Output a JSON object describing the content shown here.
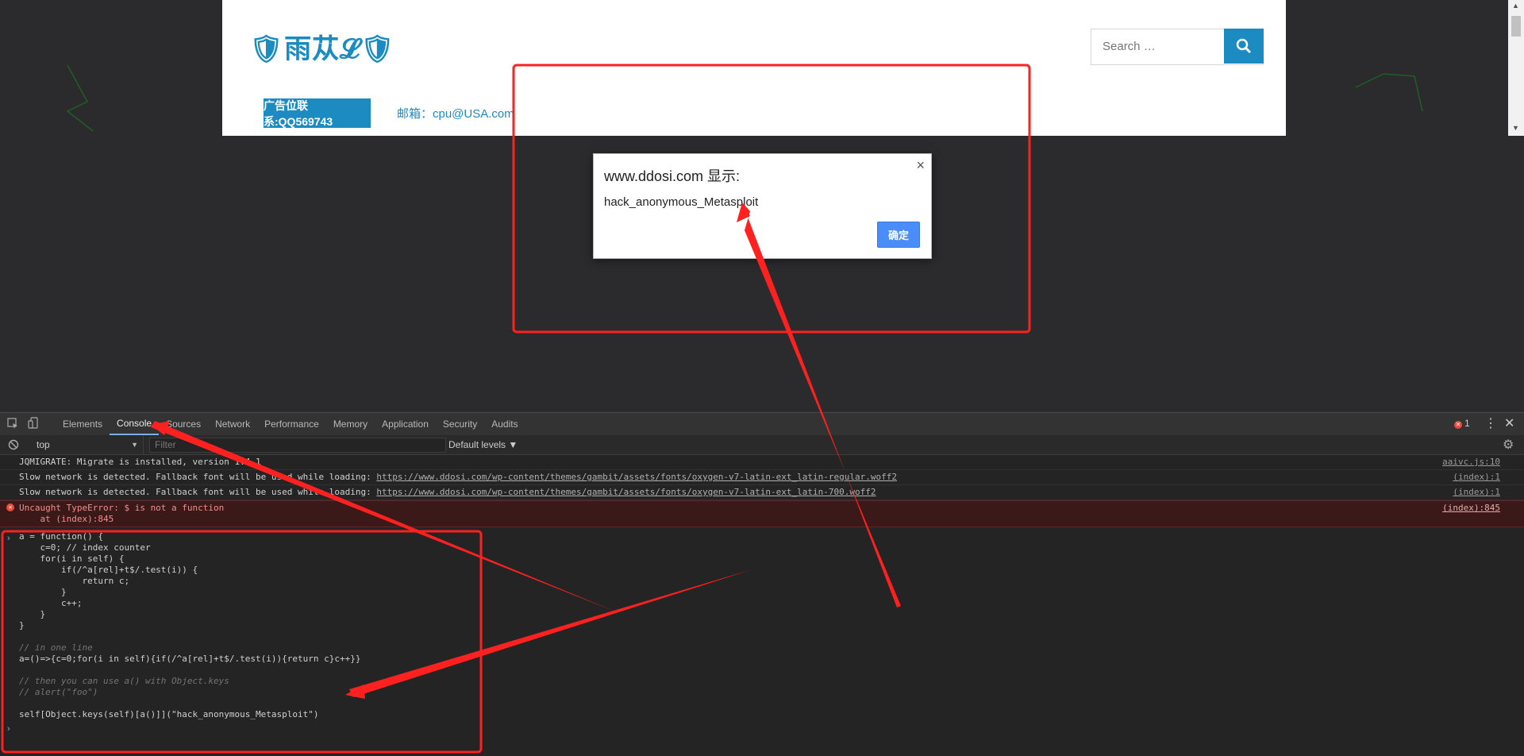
{
  "site": {
    "logo": "🛡雨苁𝓛🛡",
    "search_placeholder": "Search …",
    "ad_label": "广告位联系:QQ569743",
    "email_text": "邮箱：cpu@USA.com"
  },
  "dialog": {
    "title": "www.ddosi.com 显示:",
    "message": "hack_anonymous_Metasploit",
    "ok_label": "确定",
    "close_icon": "×"
  },
  "devtools": {
    "tabs": [
      "Elements",
      "Console",
      "Sources",
      "Network",
      "Performance",
      "Memory",
      "Application",
      "Security",
      "Audits"
    ],
    "active_tab": "Console",
    "error_count": "1",
    "context": "top",
    "filter_placeholder": "Filter",
    "levels_label": "Default levels ▼"
  },
  "console": {
    "messages": [
      {
        "text": "JQMIGRATE: Migrate is installed, version 1.4.1",
        "url": "",
        "source": "aaivc.js:10",
        "type": "log"
      },
      {
        "text": "Slow network is detected. Fallback font will be used while loading: ",
        "url": "https://www.ddosi.com/wp-content/themes/gambit/assets/fonts/oxygen-v7-latin-ext_latin-regular.woff2",
        "source": "(index):1",
        "type": "log"
      },
      {
        "text": "Slow network is detected. Fallback font will be used while loading: ",
        "url": "https://www.ddosi.com/wp-content/themes/gambit/assets/fonts/oxygen-v7-latin-ext_latin-700.woff2",
        "source": "(index):1",
        "type": "log"
      }
    ],
    "error": {
      "line1": "Uncaught TypeError: $ is not a function",
      "line2": "    at (index):845",
      "source": "(index):845"
    },
    "code_lines": [
      "a = function() {",
      "    c=0; // index counter",
      "    for(i in self) {",
      "        if(/^a[rel]+t$/.test(i)) {",
      "            return c;",
      "        }",
      "        c++;",
      "    }",
      "}",
      "",
      "// in one line",
      "a=()=>{c=0;for(i in self){if(/^a[rel]+t$/.test(i)){return c}c++}}",
      "",
      "// then you can use a() with Object.keys",
      "// alert(\"foo\")",
      "",
      "self[Object.keys(self)[a()]](\"hack_anonymous_Metasploit\")"
    ]
  },
  "colors": {
    "brand": "#1b8bc1",
    "annotation": "#ff2020",
    "devtools_bg": "#242424"
  }
}
